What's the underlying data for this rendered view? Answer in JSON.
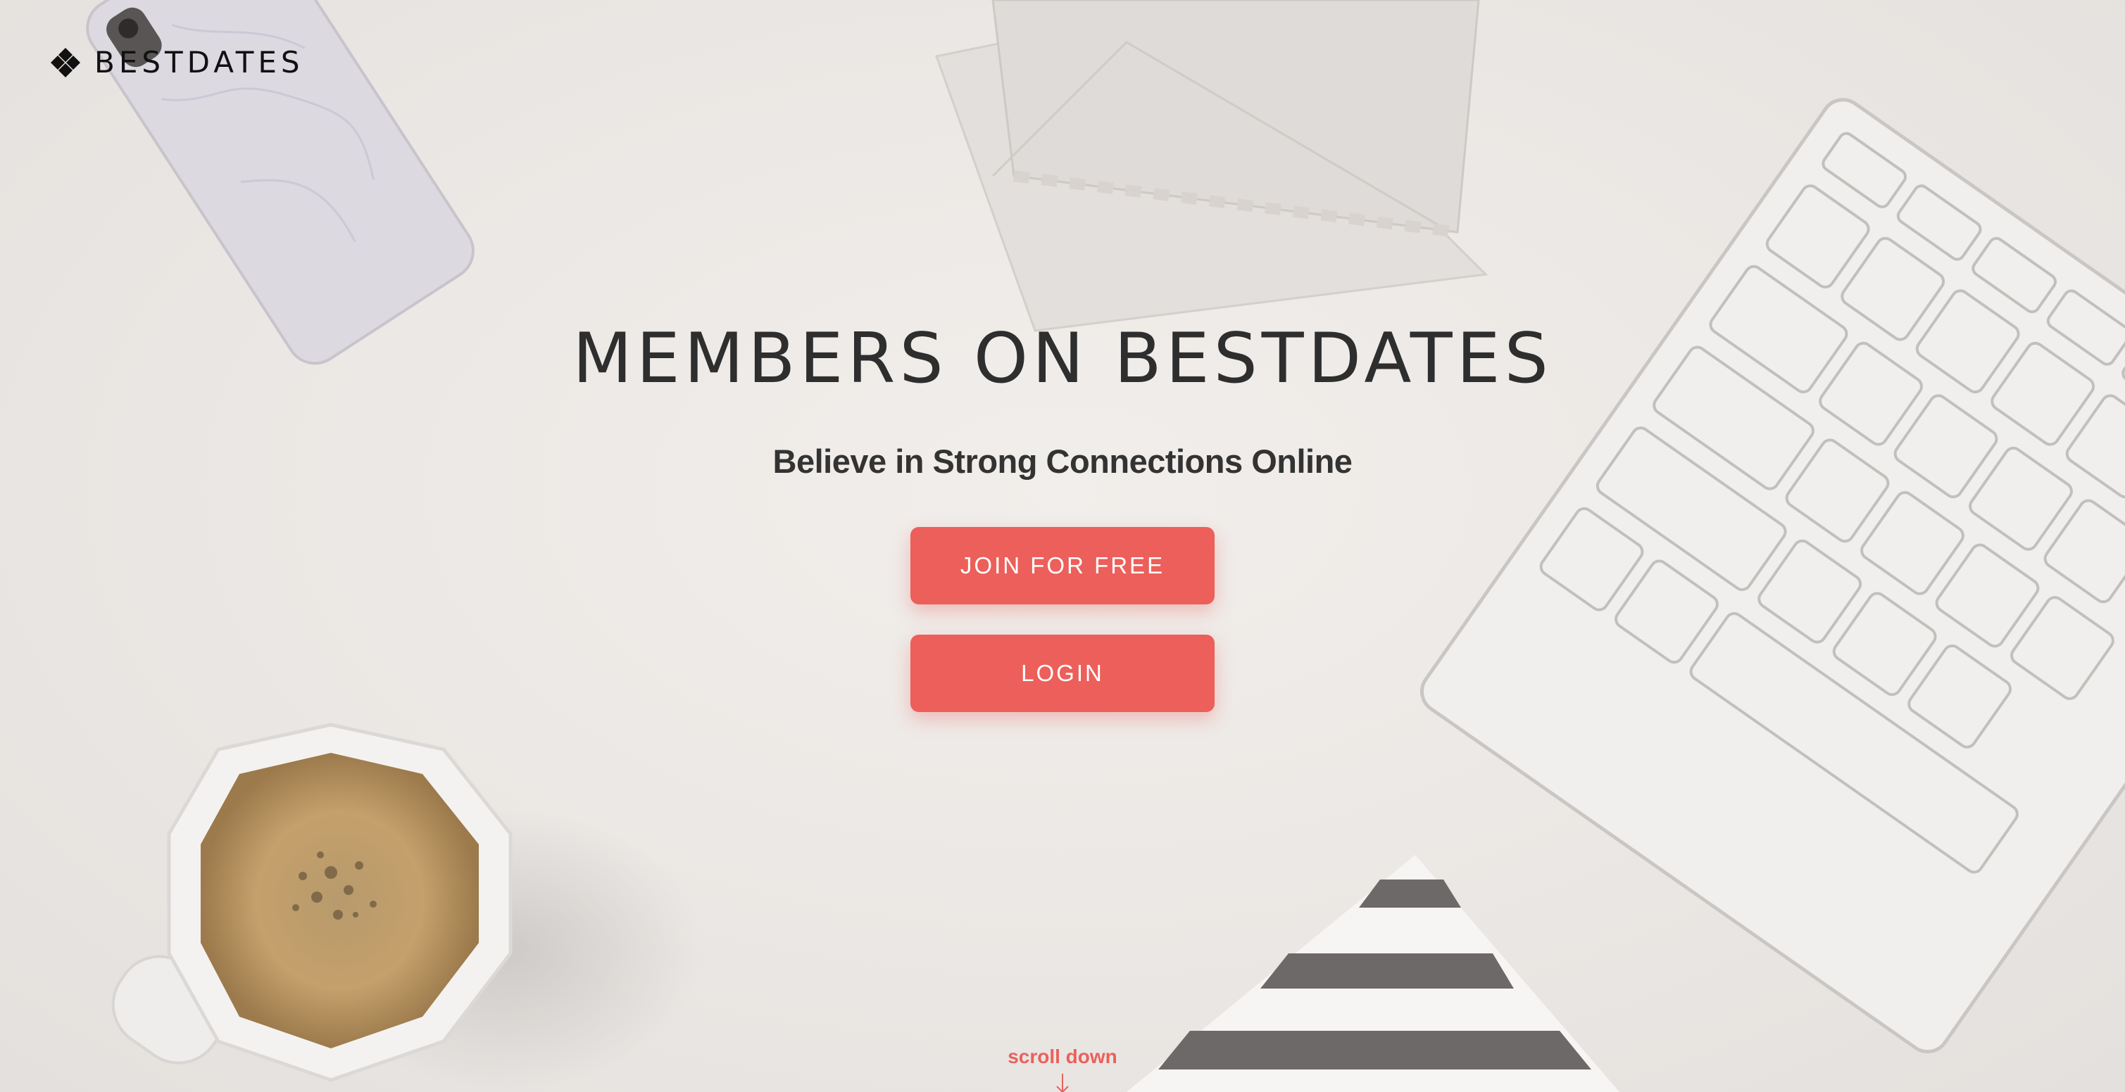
{
  "brand": {
    "name": "BESTDATES",
    "icon": "diamond-heart-logo-icon"
  },
  "hero": {
    "title": "MEMBERS ON BESTDATES",
    "subtitle": "Believe in Strong Connections Online",
    "join_label": "JOIN FOR FREE",
    "login_label": "LOGIN"
  },
  "scroll": {
    "label": "scroll down",
    "icon": "arrow-down-icon"
  },
  "colors": {
    "accent": "#ec5f5a",
    "background": "#ece8e5",
    "text_dark": "#2e2e2e"
  },
  "background_scene": {
    "description_icons": [
      "phone-icon",
      "envelope-icon",
      "keyboard-icon",
      "coffee-cup-icon",
      "striped-paper-icon"
    ]
  }
}
